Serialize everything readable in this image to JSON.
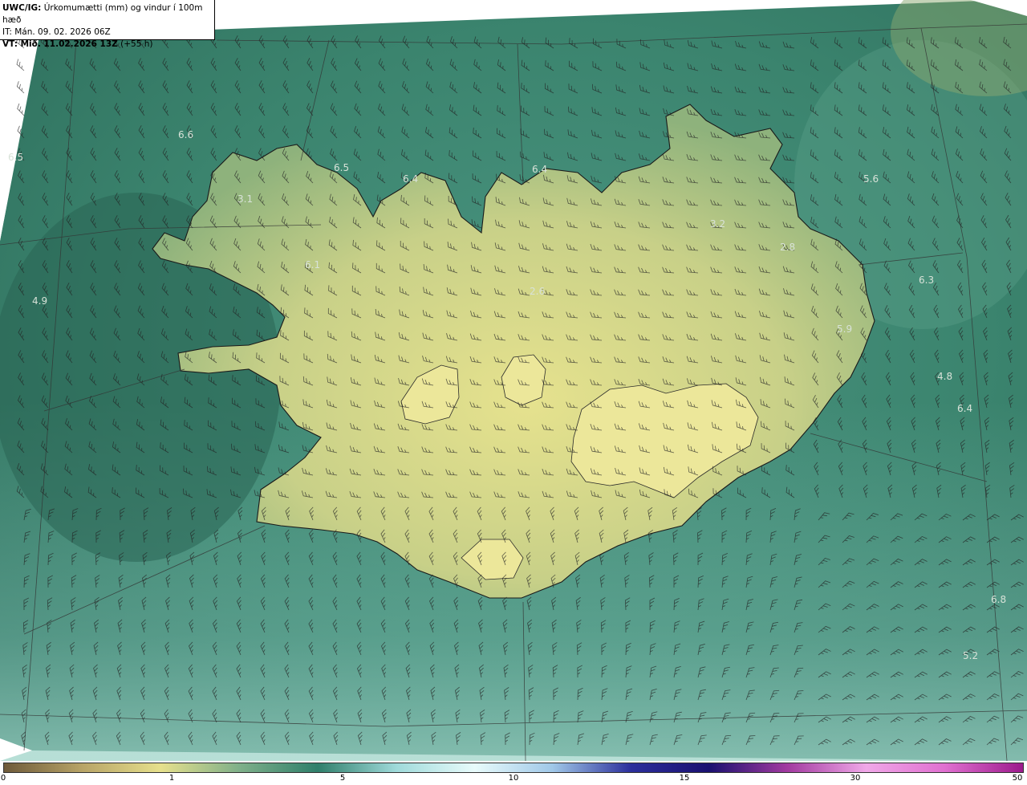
{
  "header": {
    "model": "UWC/IG:",
    "title": "Úrkomumætti (mm) og vindur í 100m hæð",
    "it_line": "IT: Mán. 09. 02. 2026 06Z",
    "vt_label": "VT: Mið. 11.02.2026 13Z",
    "vt_lead": "(+55 h)"
  },
  "legend": {
    "ticks": [
      "0",
      "1",
      "5",
      "10",
      "15",
      "30",
      "50"
    ],
    "colors": [
      "#6e5a3a",
      "#b8a467",
      "#e6e08c",
      "#7fb08a",
      "#2f7f6b",
      "#9fdada",
      "#e8fbfb",
      "#a0c8e8",
      "#2c2f9c",
      "#1a1070",
      "#a23aa0",
      "#f0a8e8",
      "#e070d0",
      "#9c1a8c"
    ]
  },
  "map": {
    "colors": {
      "ocean_dark": "#2e6e5c",
      "ocean_mid": "#3f8a74",
      "ocean_light": "#7ec0b2",
      "land_low": "#8eb27c",
      "land_high": "#e2e08e",
      "coast": "#1a1a1a",
      "grid": "#333333",
      "barb": "#222222"
    },
    "labels": [
      "6.5",
      "6.6",
      "6.5",
      "6.4",
      "6.4",
      "5.6",
      "3.1",
      "3.2",
      "2.8",
      "6.1",
      "4.9",
      "6.3",
      "2.6",
      "5.9",
      "4.8",
      "6.4",
      "6.8",
      "5.2"
    ]
  }
}
